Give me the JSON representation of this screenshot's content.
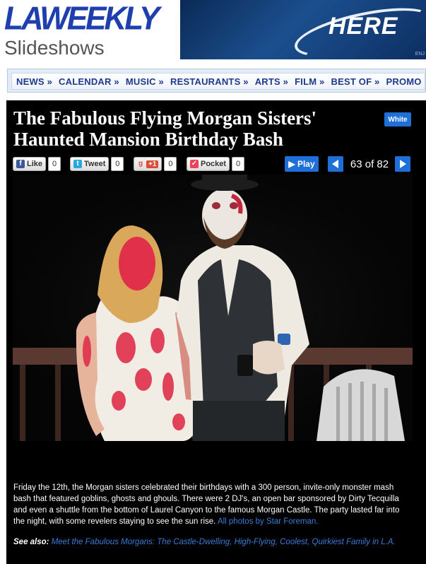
{
  "header": {
    "logo_text": "LAWEEKLY",
    "section_title": "Slideshows",
    "ad_text": "HERE",
    "ad_small": "ENJ"
  },
  "nav": {
    "items": [
      "NEWS »",
      "CALENDAR »",
      "MUSIC »",
      "RESTAURANTS »",
      "ARTS »",
      "FILM »",
      "BEST OF »",
      "PROMO »"
    ]
  },
  "slideshow": {
    "title": "The Fabulous Flying Morgan Sisters' Haunted Mansion Birthday Bash",
    "white_button": "White",
    "social": {
      "like_label": "Like",
      "like_count": "0",
      "tweet_label": "Tweet",
      "tweet_count": "0",
      "plus_label": "+1",
      "plus_count": "0",
      "pocket_label": "Pocket",
      "pocket_count": "0"
    },
    "play_label": "▶ Play",
    "counter": "63 of 82",
    "caption": "Friday the 12th, the Morgan sisters celebrated their birthdays with a 300 person, invite-only monster mash bash that featured goblins, ghosts and ghouls. There were 2 DJ's, an open bar sponsored by Dirty Tecquilla and even a shuttle from the bottom of Laurel Canyon to the famous Morgan Castle. The party lasted far into the night, with some revelers staying to see the sun rise.",
    "caption_link": "All photos by Star Foreman.",
    "see_also_label": "See also:",
    "see_also_link": "Meet the Fabulous Morgans: The Castle-Dwelling, High-Flying, Coolest, Quirkiest Family in L.A."
  },
  "colors": {
    "brand_blue": "#1f3fae",
    "button_blue": "#1f6fd8",
    "link_blue": "#3a7bd8",
    "nav_text": "#1f3a8a"
  }
}
